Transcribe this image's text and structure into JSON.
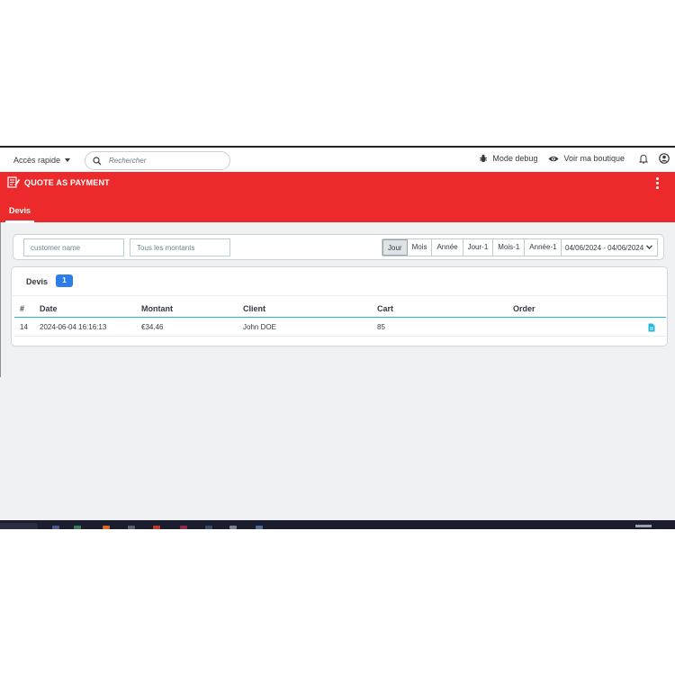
{
  "topbar": {
    "quick_access": "Accès rapide",
    "search_placeholder": "Rechercher",
    "debug_label": "Mode debug",
    "shop_label": "Voir ma boutique"
  },
  "header": {
    "title": "QUOTE AS PAYMENT",
    "tab": "Devis"
  },
  "filters": {
    "name_placeholder": "customer name",
    "amount_placeholder": "Tous les montants",
    "periods": [
      "Jour",
      "Mois",
      "Année",
      "Jour-1",
      "Mois-1",
      "Année-1"
    ],
    "active_period": "Jour",
    "date_range": "04/06/2024 - 04/06/2024"
  },
  "table": {
    "title": "Devis",
    "count": "1",
    "columns": [
      "#",
      "Date",
      "Montant",
      "Client",
      "Cart",
      "Order"
    ],
    "rows": [
      {
        "id": "14",
        "date": "2024-06-04 16:16:13",
        "amount": "€34.46",
        "client": "John DOE",
        "cart": "85",
        "order": ""
      }
    ]
  },
  "colors": {
    "brand_red": "#ec2a2c",
    "badge_blue": "#2b7de9",
    "accent_cyan": "#25b9d7"
  }
}
